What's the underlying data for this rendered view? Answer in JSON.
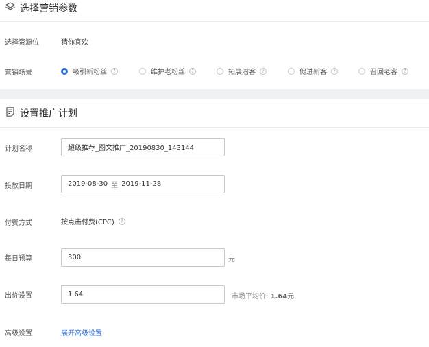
{
  "section1": {
    "title": "选择营销参数",
    "resource_label": "选择资源位",
    "resource_value": "猜你喜欢",
    "scene_label": "营销场景",
    "scene_options": [
      {
        "label": "吸引新粉丝",
        "selected": true
      },
      {
        "label": "维护老粉丝",
        "selected": false
      },
      {
        "label": "拓展潜客",
        "selected": false
      },
      {
        "label": "促进新客",
        "selected": false
      },
      {
        "label": "召回老客",
        "selected": false
      }
    ]
  },
  "section2": {
    "title": "设置推广计划",
    "plan_name_label": "计划名称",
    "plan_name_value": "超级推荐_图文推广_20190830_143144",
    "date_label": "投放日期",
    "date_start": "2019-08-30",
    "date_sep": "至",
    "date_end": "2019-11-28",
    "payment_label": "付费方式",
    "payment_value": "按点击付费(CPC)",
    "budget_label": "每日预算",
    "budget_value": "300",
    "budget_unit": "元",
    "bid_label": "出价设置",
    "bid_value": "1.64",
    "market_avg_prefix": "市场平均价:",
    "market_avg_value": "1.64",
    "market_avg_unit": "元",
    "advanced_label": "高级设置",
    "advanced_link": "展开高级设置"
  },
  "colors": {
    "accent": "#2f6fd8",
    "band": "#f0f1f5",
    "divider": "#ebebeb"
  }
}
